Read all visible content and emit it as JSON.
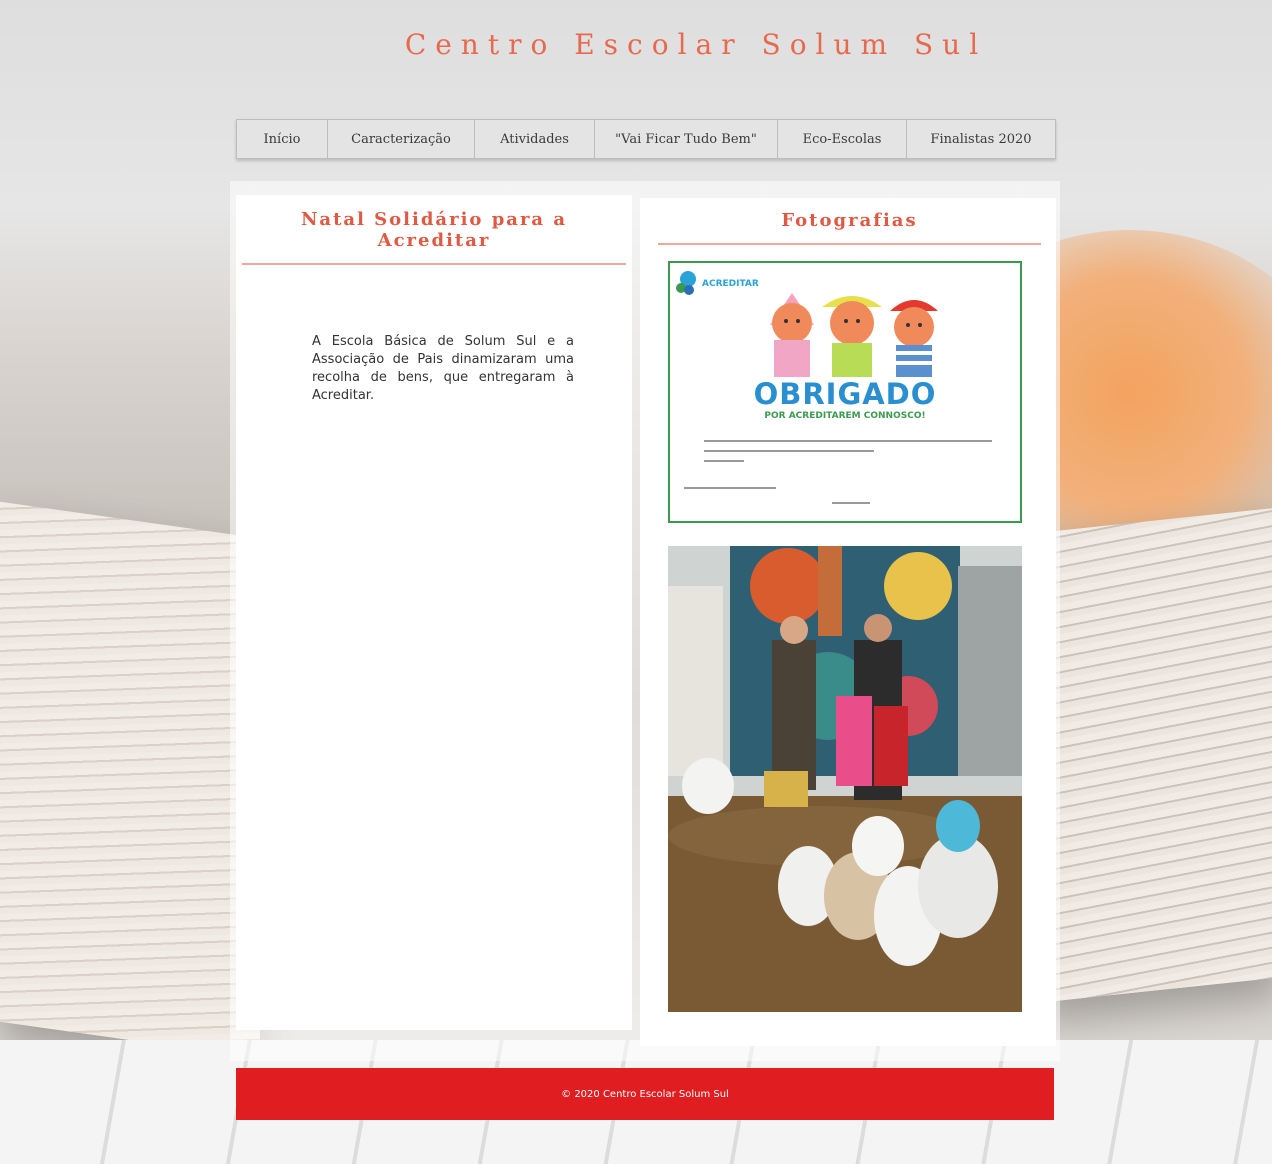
{
  "site": {
    "title": "Centro Escolar Solum Sul"
  },
  "nav": {
    "items": [
      {
        "label": "Início"
      },
      {
        "label": "Caracterização"
      },
      {
        "label": "Atividades"
      },
      {
        "label": "\"Vai Ficar Tudo Bem\""
      },
      {
        "label": "Eco-Escolas"
      },
      {
        "label": "Finalistas 2020"
      }
    ]
  },
  "article": {
    "title": "Natal Solidário para a Acreditar",
    "body": "A Escola Básica de Solum Sul e a Associação de Pais dinamizaram uma recolha de bens, que entregaram à Acreditar."
  },
  "gallery": {
    "title": "Fotografias",
    "photo1": {
      "logo_text": "ACREDITAR",
      "headline": "OBRIGADO",
      "subheadline": "POR ACREDITAREM CONNOSCO!"
    }
  },
  "footer": {
    "copyright": "© 2020 Centro Escolar Solum Sul"
  },
  "colors": {
    "accent": "#e05a43",
    "footer": "#e01e21",
    "green": "#3c9a4f",
    "blue": "#2a8fd0"
  }
}
